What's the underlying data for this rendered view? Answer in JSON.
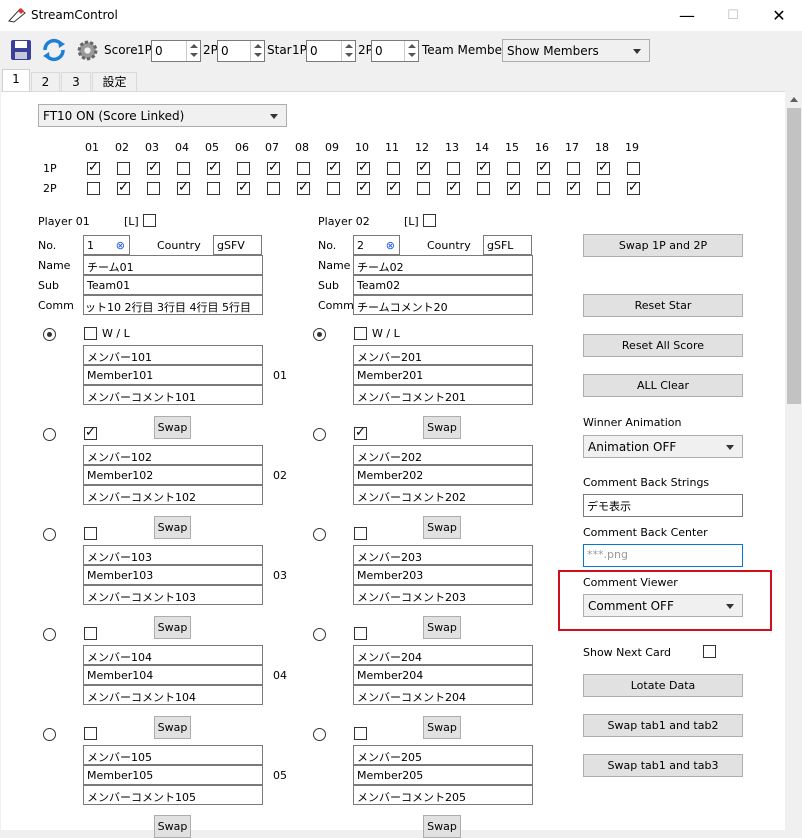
{
  "window": {
    "title": "StreamControl",
    "min": "—",
    "max": "☐",
    "close": "✕"
  },
  "toolbar": {
    "score_label": "Score",
    "p1": "1P",
    "p2": "2P",
    "score1": "0",
    "score2": "0",
    "star_label": "Star",
    "star1": "0",
    "star2": "0",
    "team_members_label": "Team Members",
    "team_members_value": "Show Members"
  },
  "tabs": [
    "1",
    "2",
    "3",
    "設定"
  ],
  "mode": "FT10 ON (Score Linked)",
  "games": {
    "numbers": [
      "01",
      "02",
      "03",
      "04",
      "05",
      "06",
      "07",
      "08",
      "09",
      "10",
      "11",
      "12",
      "13",
      "14",
      "15",
      "16",
      "17",
      "18",
      "19"
    ],
    "row1_label": "1P",
    "row2_label": "2P",
    "row1": [
      true,
      false,
      true,
      false,
      true,
      false,
      true,
      false,
      true,
      true,
      false,
      true,
      false,
      true,
      false,
      true,
      false,
      true,
      false
    ],
    "row2": [
      false,
      true,
      false,
      true,
      false,
      true,
      false,
      true,
      false,
      true,
      true,
      false,
      true,
      false,
      true,
      false,
      true,
      false,
      true
    ]
  },
  "player1": {
    "title": "Player 01",
    "l_label": "[L]",
    "no_label": "No.",
    "no": "1",
    "country_label": "Country",
    "country": "gSFV",
    "name_label": "Name",
    "name": "チーム01",
    "sub_label": "Sub",
    "sub": "Team01",
    "comm_label": "Comm",
    "comm": "ット10 2行目 3行目 4行目 5行目"
  },
  "player2": {
    "title": "Player 02",
    "l_label": "[L]",
    "no_label": "No.",
    "no": "2",
    "country_label": "Country",
    "country": "gSFL",
    "name_label": "Name",
    "name": "チーム02",
    "sub_label": "Sub",
    "sub": "Team02",
    "comm_label": "Comm",
    "comm": "チームコメント20"
  },
  "wl_label": "W / L",
  "swap_label": "Swap",
  "members": [
    {
      "num": "01",
      "a1": "メンバー101",
      "a2": "Member101",
      "a3": "メンバーコメント101",
      "b1": "メンバー201",
      "b2": "Member201",
      "b3": "メンバーコメント201"
    },
    {
      "num": "02",
      "a1": "メンバー102",
      "a2": "Member102",
      "a3": "メンバーコメント102",
      "b1": "メンバー202",
      "b2": "Member202",
      "b3": "メンバーコメント202"
    },
    {
      "num": "03",
      "a1": "メンバー103",
      "a2": "Member103",
      "a3": "メンバーコメント103",
      "b1": "メンバー203",
      "b2": "Member203",
      "b3": "メンバーコメント203"
    },
    {
      "num": "04",
      "a1": "メンバー104",
      "a2": "Member104",
      "a3": "メンバーコメント104",
      "b1": "メンバー204",
      "b2": "Member204",
      "b3": "メンバーコメント204"
    },
    {
      "num": "05",
      "a1": "メンバー105",
      "a2": "Member105",
      "a3": "メンバーコメント105",
      "b1": "メンバー205",
      "b2": "Member205",
      "b3": "メンバーコメント205"
    }
  ],
  "right": {
    "swap_players": "Swap 1P and 2P",
    "reset_star": "Reset Star",
    "reset_all_score": "Reset All Score",
    "all_clear": "ALL Clear",
    "winner_animation_label": "Winner Animation",
    "winner_animation_value": "Animation OFF",
    "comment_back_strings_label": "Comment Back Strings",
    "comment_back_strings_value": "デモ表示",
    "comment_back_center_label": "Comment Back Center",
    "comment_back_center_placeholder": "***.png",
    "comment_viewer_label": "Comment Viewer",
    "comment_viewer_value": "Comment OFF",
    "show_next_card_label": "Show Next Card",
    "lotate_data": "Lotate Data",
    "swap_tab12": "Swap tab1 and tab2",
    "swap_tab13": "Swap tab1 and tab3"
  },
  "colors": {
    "highlight": "#d10f1c",
    "save_icon": "#3a3f9a",
    "refresh_icon": "#1e7fd8"
  }
}
